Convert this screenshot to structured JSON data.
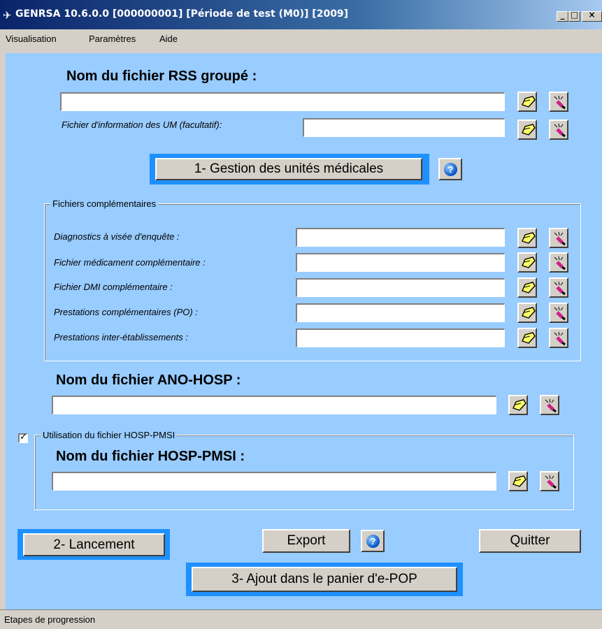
{
  "window": {
    "title": "GENRSA 10.6.0.0 [000000001] [Période de test (M0)] [2009]",
    "app_icon": "plane-icon",
    "controls": [
      "_",
      "□",
      "×"
    ]
  },
  "menu": [
    "Visualisation",
    "Paramètres",
    "Aide"
  ],
  "rss": {
    "heading": "Nom du fichier RSS groupé :",
    "value": ""
  },
  "um_file": {
    "label": "Fichier d'information des UM (facultatif):",
    "value": ""
  },
  "buttons": {
    "gestion": "1- Gestion des unités médicales",
    "lancement": "2- Lancement",
    "export": "Export",
    "quitter": "Quitter",
    "ajout": "3- Ajout dans le panier d'e-POP",
    "help": "?"
  },
  "complementaires": {
    "title": "Fichiers complémentaires",
    "fields": [
      {
        "label": "Diagnostics à visée d'enquête :",
        "value": ""
      },
      {
        "label": "Fichier médicament complémentaire :",
        "value": ""
      },
      {
        "label": "Fichier DMI complémentaire :",
        "value": ""
      },
      {
        "label": "Prestations complémentaires (PO) :",
        "value": ""
      },
      {
        "label": "Prestations inter-établissements :",
        "value": ""
      }
    ]
  },
  "ano_hosp": {
    "heading": "Nom du fichier ANO-HOSP :",
    "value": ""
  },
  "hosp_pmsi": {
    "group_title": "Utilisation du fichier HOSP-PMSI",
    "checked": true,
    "heading": "Nom du fichier HOSP-PMSI :",
    "value": ""
  },
  "statusbar": {
    "text": "Etapes de progression"
  },
  "colors": {
    "client_bg": "#99ccff",
    "highlight": "#1e90ff"
  }
}
